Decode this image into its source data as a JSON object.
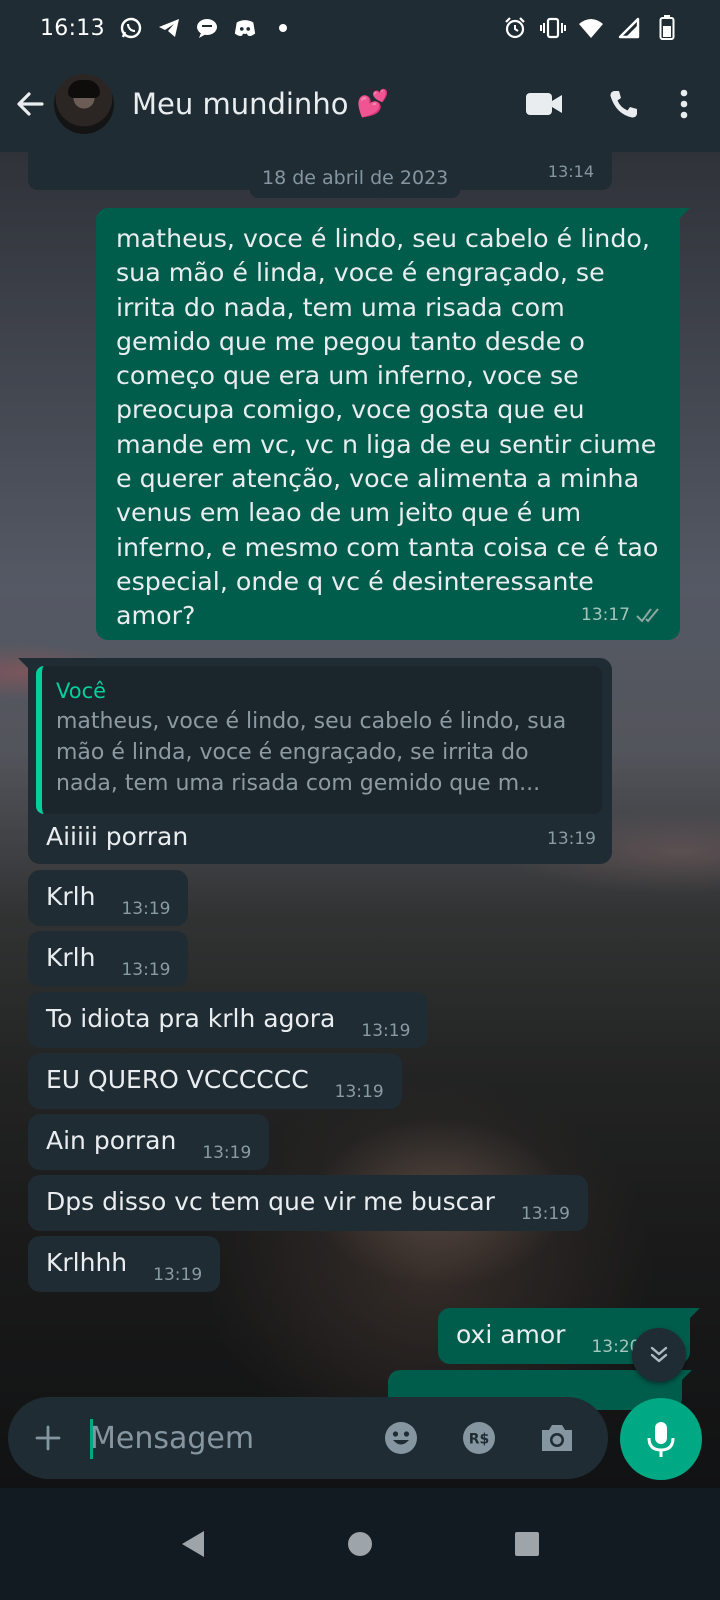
{
  "status_bar": {
    "time": "16:13",
    "left_icons": [
      "whatsapp-icon",
      "telegram-icon",
      "chat-bubble-icon",
      "discord-icon",
      "dot-icon"
    ],
    "right_icons": [
      "alarm-icon",
      "vibrate-icon",
      "wifi-icon",
      "signal-icon",
      "battery-icon"
    ]
  },
  "header": {
    "title": "Meu mundinho",
    "title_emoji": "💕",
    "actions": [
      "video-call-icon",
      "voice-call-icon",
      "more-options-icon"
    ]
  },
  "date_chip": "18 de abril de 2023",
  "top_partial_time": "13:14",
  "messages": {
    "long_out": {
      "text": "matheus, voce é lindo, seu cabelo é lindo, sua mão é linda, voce é engraçado, se irrita do nada, tem uma risada com gemido que me pegou tanto desde o começo que era um inferno, voce se preocupa comigo, voce gosta que eu mande em vc, vc n liga de eu sentir ciume e querer atenção, voce alimenta a minha venus em leao de um jeito que é um inferno, e mesmo com tanta coisa ce é tao especial, onde q vc é desinteressante amor?",
      "time": "13:17"
    },
    "reply_in": {
      "quote_author": "Você",
      "quote_text": "matheus, voce é lindo, seu cabelo é lindo, sua mão é linda, voce é engraçado, se irrita do nada, tem uma risada com gemido que m...",
      "text": "Aiiiii porran",
      "time": "13:19"
    },
    "small_in": [
      {
        "text": "Krlh",
        "time": "13:19"
      },
      {
        "text": "Krlh",
        "time": "13:19"
      },
      {
        "text": "To idiota pra krlh agora",
        "time": "13:19"
      },
      {
        "text": "EU QUERO VCCCCCC",
        "time": "13:19"
      },
      {
        "text": "Ain porran",
        "time": "13:19"
      },
      {
        "text": "Dps disso vc tem que vir me buscar",
        "time": "13:19"
      },
      {
        "text": "Krlhhh",
        "time": "13:19"
      }
    ],
    "small_out": {
      "text": "oxi amor",
      "time": "13:20"
    }
  },
  "composer": {
    "placeholder": "Mensagem",
    "icons": [
      "plus-icon",
      "emoji-icon",
      "payment-icon",
      "camera-icon",
      "microphone-icon"
    ],
    "payment_label": "R$"
  },
  "colors": {
    "header_bg": "#1f2c34",
    "incoming_bubble": "#1f2c34",
    "outgoing_bubble": "#005c4b",
    "accent": "#00a884",
    "quote_accent": "#06cf9c"
  }
}
